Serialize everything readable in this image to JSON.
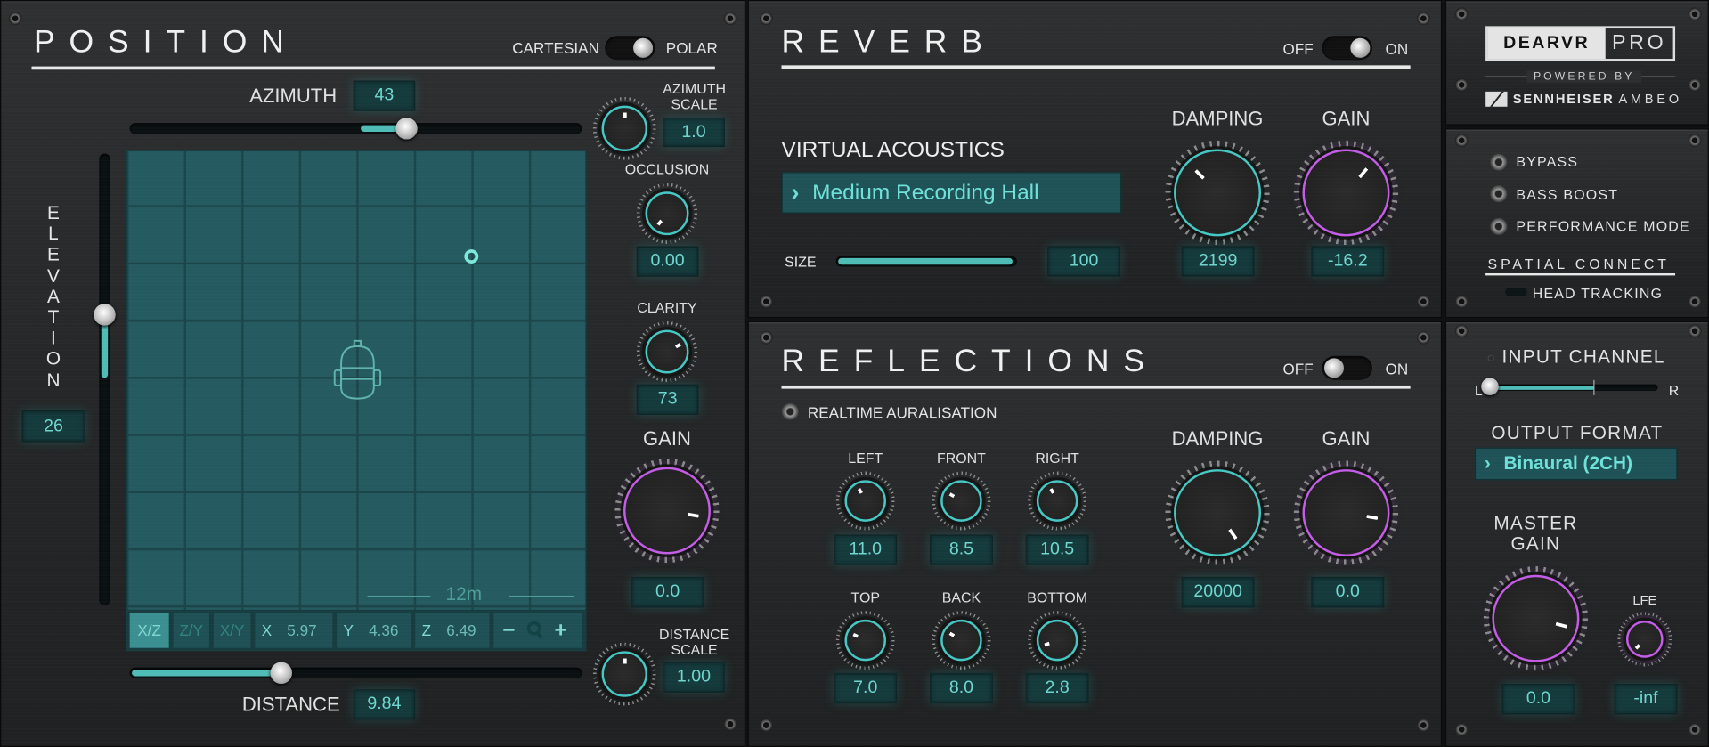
{
  "position": {
    "title": "POSITION",
    "mode_left": "CARTESIAN",
    "mode_right": "POLAR",
    "azimuth_label": "AZIMUTH",
    "azimuth_value": "43",
    "azimuth_scale_label": [
      "AZIMUTH",
      "SCALE"
    ],
    "azimuth_scale_value": "1.0",
    "elevation_label": [
      "E",
      "L",
      "E",
      "V",
      "A",
      "T",
      "I",
      "O",
      "N"
    ],
    "elevation_value": "26",
    "occlusion_label": "OCCLUSION",
    "occlusion_value": "0.00",
    "clarity_label": "CLARITY",
    "clarity_value": "73",
    "gain_label": "GAIN",
    "gain_value": "0.0",
    "distance_label": "DISTANCE",
    "distance_value": "9.84",
    "distance_scale_label": [
      "DISTANCE",
      "SCALE"
    ],
    "distance_scale_value": "1.00",
    "grid_scale": "12m",
    "views": [
      "X/Z",
      "Z/Y",
      "X/Y"
    ],
    "coords": [
      {
        "axis": "X",
        "value": "5.97"
      },
      {
        "axis": "Y",
        "value": "4.36"
      },
      {
        "axis": "Z",
        "value": "6.49"
      }
    ],
    "zoom_minus": "−",
    "zoom_plus": "+"
  },
  "reverb": {
    "title": "REVERB",
    "off": "OFF",
    "on": "ON",
    "virtual_acoustics_label": "VIRTUAL ACOUSTICS",
    "preset": "Medium Recording Hall",
    "size_label": "SIZE",
    "size_value": "100",
    "damping_label": "DAMPING",
    "damping_value": "2199",
    "gain_label": "GAIN",
    "gain_value": "-16.2"
  },
  "reflections": {
    "title": "REFLECTIONS",
    "off": "OFF",
    "on": "ON",
    "realtime_label": "REALTIME AURALISATION",
    "walls": [
      {
        "label": "LEFT",
        "value": "11.0"
      },
      {
        "label": "FRONT",
        "value": "8.5"
      },
      {
        "label": "RIGHT",
        "value": "10.5"
      },
      {
        "label": "TOP",
        "value": "7.0"
      },
      {
        "label": "BACK",
        "value": "8.0"
      },
      {
        "label": "BOTTOM",
        "value": "2.8"
      }
    ],
    "damping_label": "DAMPING",
    "damping_value": "20000",
    "gain_label": "GAIN",
    "gain_value": "0.0"
  },
  "brand": {
    "logo_left": "DEARVR",
    "logo_right": "PRO",
    "powered_by": "POWERED BY",
    "sennheiser": "SENNHEISER",
    "ambeo": "AMBEO"
  },
  "options": {
    "bypass": "BYPASS",
    "bass_boost": "BASS BOOST",
    "performance_mode": "PERFORMANCE MODE",
    "spatial_connect": "SPATIAL CONNECT",
    "head_tracking": "HEAD TRACKING"
  },
  "output": {
    "input_channel_label": "INPUT CHANNEL",
    "left": "L",
    "right": "R",
    "output_format_label": "OUTPUT FORMAT",
    "output_format": "Binaural (2CH)",
    "master_gain_label": [
      "MASTER",
      "GAIN"
    ],
    "master_gain_value": "0.0",
    "lfe_label": "LFE",
    "lfe_value": "-inf"
  },
  "colors": {
    "accent": "#4fbcb6",
    "gain": "#c35ce6",
    "grid": "#245a60"
  }
}
